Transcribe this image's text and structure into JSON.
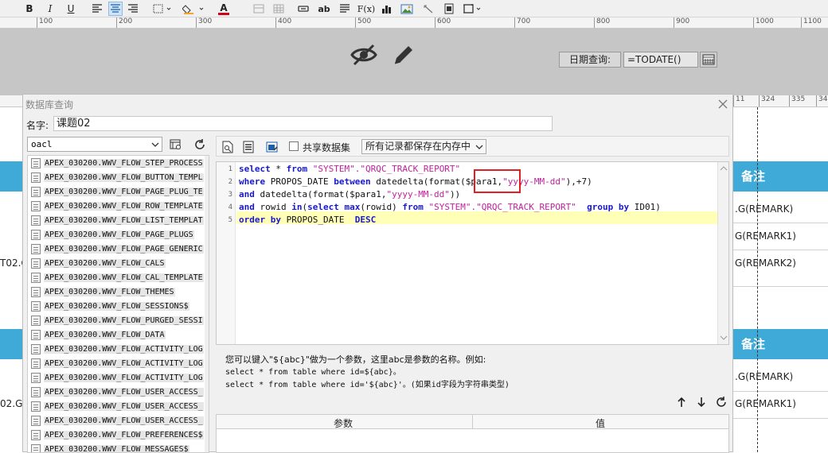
{
  "toolbar": {
    "buttons": [
      {
        "name": "bold",
        "glyph": "B"
      },
      {
        "name": "italic",
        "glyph": "I"
      },
      {
        "name": "underline",
        "glyph": "U"
      },
      {
        "name": "align-left",
        "glyph": ""
      },
      {
        "name": "align-center",
        "glyph": ""
      },
      {
        "name": "align-right",
        "glyph": ""
      },
      {
        "name": "border",
        "glyph": ""
      },
      {
        "name": "fill-color",
        "glyph": ""
      },
      {
        "name": "font-color",
        "glyph": "A"
      },
      {
        "name": "merge",
        "glyph": ""
      },
      {
        "name": "grid",
        "glyph": ""
      },
      {
        "name": "insert-link",
        "glyph": ""
      },
      {
        "name": "insert-text",
        "glyph": "ab"
      },
      {
        "name": "insert-paragraph",
        "glyph": ""
      },
      {
        "name": "insert-formula",
        "glyph": "F(x)"
      },
      {
        "name": "insert-chart",
        "glyph": ""
      },
      {
        "name": "insert-image",
        "glyph": ""
      },
      {
        "name": "insert-line",
        "glyph": ""
      },
      {
        "name": "insert-barcode",
        "glyph": ""
      },
      {
        "name": "insert-frame",
        "glyph": ""
      }
    ],
    "colors": {
      "fill": "#f6a623",
      "font": "#d0021b"
    }
  },
  "ruler": {
    "ticks": [
      "100",
      "200",
      "300",
      "400",
      "500",
      "600",
      "700",
      "800",
      "900",
      "1000",
      "1100"
    ]
  },
  "ruler2": {
    "ticks": [
      "11",
      "324",
      "335",
      "34"
    ]
  },
  "report": {
    "date_label": "日期查询:",
    "date_value": "=TODATE()"
  },
  "bg_table": {
    "header": "备注",
    "rows": [
      ".G(REMARK)",
      "G(REMARK1)",
      "G(REMARK2)"
    ],
    "header2": "备注",
    "rows2": [
      ".G(REMARK)",
      "G(REMARK1)"
    ],
    "left_rows": [
      "T02.C",
      "02.G("
    ]
  },
  "dialog": {
    "title": "数据库查询",
    "name_label": "名字:",
    "name_value": "课题02",
    "datasource": "oacl",
    "tables": [
      "APEX_030200.WWV_FLOW_STEP_PROCESS",
      "APEX_030200.WWV_FLOW_BUTTON_TEMPL",
      "APEX_030200.WWV_FLOW_PAGE_PLUG_TE",
      "APEX_030200.WWV_FLOW_ROW_TEMPLATE",
      "APEX_030200.WWV_FLOW_LIST_TEMPLAT",
      "APEX_030200.WWV_FLOW_PAGE_PLUGS",
      "APEX_030200.WWV_FLOW_PAGE_GENERIC",
      "APEX_030200.WWV_FLOW_CALS",
      "APEX_030200.WWV_FLOW_CAL_TEMPLATE",
      "APEX_030200.WWV_FLOW_THEMES",
      "APEX_030200.WWV_FLOW_SESSIONS$",
      "APEX_030200.WWV_FLOW_PURGED_SESSI",
      "APEX_030200.WWV_FLOW_DATA",
      "APEX_030200.WWV_FLOW_ACTIVITY_LOG",
      "APEX_030200.WWV_FLOW_ACTIVITY_LOG",
      "APEX_030200.WWV_FLOW_ACTIVITY_LOG",
      "APEX_030200.WWV_FLOW_USER_ACCESS_",
      "APEX_030200.WWV_FLOW_USER_ACCESS_",
      "APEX_030200.WWV_FLOW_USER_ACCESS_",
      "APEX_030200.WWV_FLOW_PREFERENCES$",
      "APEX_030200.WWV_FLOW_MESSAGES$"
    ],
    "share_label": "共享数据集",
    "mode_value": "所有记录都保存在内存中",
    "line_numbers": [
      "1",
      "2",
      "3",
      "4",
      "5"
    ],
    "sql": {
      "l1_kw1": "select",
      "l1_t1": " * ",
      "l1_kw2": "from",
      "l1_s1": " \"SYSTEM\".\"QRQC_TRACK_REPORT\"",
      "l2_kw1": "where",
      "l2_t1": " PROPOS_DATE ",
      "l2_kw2": "between",
      "l2_t2": " datedelta(format(",
      "l2_t3": "$para1,",
      "l2_s1": "\"yyyy-MM-dd\"",
      "l2_t4": "),+7)",
      "l3_kw1": "and",
      "l3_t1": " datedelta(format($para1,",
      "l3_s1": "\"yyyy-MM-dd\"",
      "l3_t2": "))",
      "l4_kw1": "and",
      "l4_t1": " rowid ",
      "l4_kw2": "in",
      "l4_t2": "(",
      "l4_kw3": "select",
      "l4_t3": " ",
      "l4_kw4": "max",
      "l4_t4": "(rowid) ",
      "l4_kw5": "from",
      "l4_s1": " \"SYSTEM\".\"QRQC_TRACK_REPORT\"",
      "l4_t5": "  ",
      "l4_kw6": "group by",
      "l4_t6": " ID01)",
      "l5_kw1": "order by",
      "l5_t1": " PROPOS_DATE  ",
      "l5_kw2": "DESC"
    },
    "help": {
      "line1": "您可以键入\"${abc}\"做为一个参数，这里abc是参数的名称。例如:",
      "line2": "select * from table where id=${abc}。",
      "line3": "select * from table where id='${abc}'。(如果id字段为字符串类型)"
    },
    "params_col1": "参数",
    "params_col2": "值"
  }
}
